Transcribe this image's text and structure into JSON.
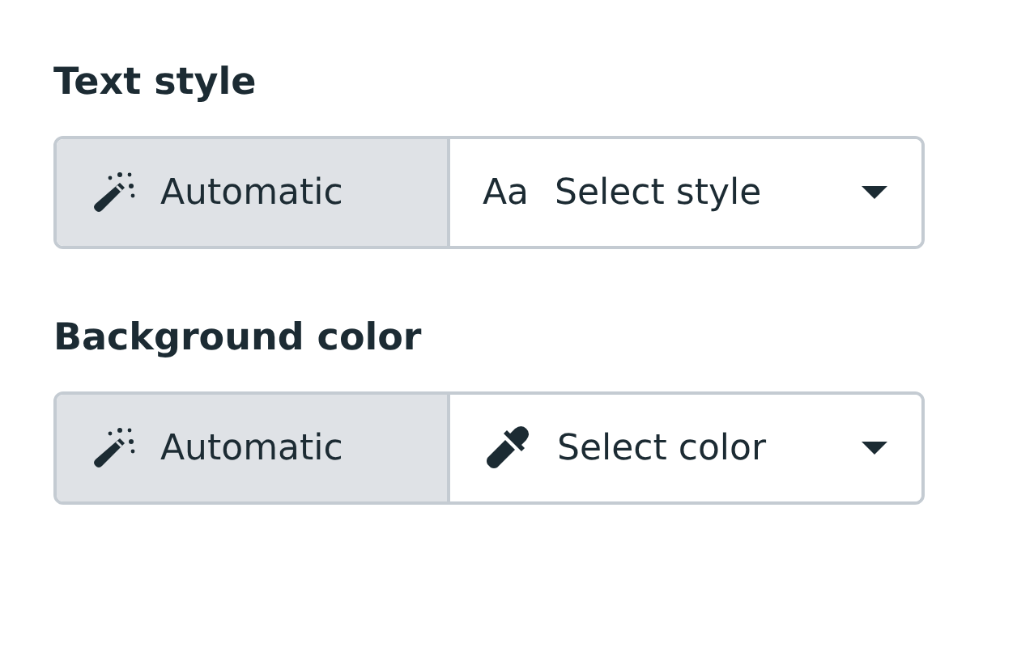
{
  "sections": [
    {
      "title": "Text style",
      "options": [
        {
          "kind": "auto",
          "label": "Automatic",
          "selected": true
        },
        {
          "kind": "style",
          "glyph": "Aa",
          "label": "Select style",
          "selected": false
        }
      ]
    },
    {
      "title": "Background color",
      "options": [
        {
          "kind": "auto",
          "label": "Automatic",
          "selected": true
        },
        {
          "kind": "color",
          "label": "Select color",
          "selected": false
        }
      ]
    }
  ]
}
